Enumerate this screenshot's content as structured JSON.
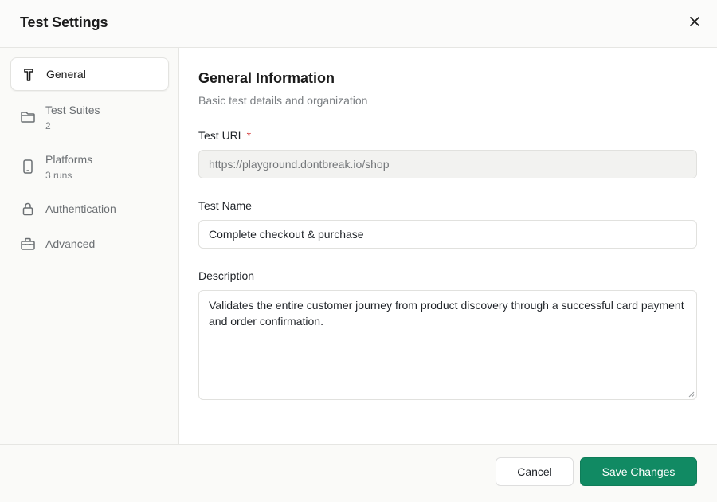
{
  "dialog": {
    "title": "Test Settings",
    "close_icon": "close-icon"
  },
  "sidebar": {
    "items": [
      {
        "label": "General",
        "sub": "",
        "icon": "hammer-icon",
        "active": true
      },
      {
        "label": "Test Suites",
        "sub": "2",
        "icon": "folder-icon",
        "active": false
      },
      {
        "label": "Platforms",
        "sub": "3 runs",
        "icon": "phone-icon",
        "active": false
      },
      {
        "label": "Authentication",
        "sub": "",
        "icon": "lock-icon",
        "active": false
      },
      {
        "label": "Advanced",
        "sub": "",
        "icon": "toolbox-icon",
        "active": false
      }
    ]
  },
  "main": {
    "title": "General Information",
    "subtitle": "Basic test details and organization",
    "test_url": {
      "label": "Test URL",
      "required_mark": "*",
      "value": "https://playground.dontbreak.io/shop"
    },
    "test_name": {
      "label": "Test Name",
      "value": "Complete checkout & purchase"
    },
    "description": {
      "label": "Description",
      "value": "Validates the entire customer journey from product discovery through a successful card payment and order confirmation."
    }
  },
  "footer": {
    "cancel_label": "Cancel",
    "save_label": "Save Changes"
  },
  "colors": {
    "accent": "#118a63",
    "required": "#d43a3a"
  }
}
